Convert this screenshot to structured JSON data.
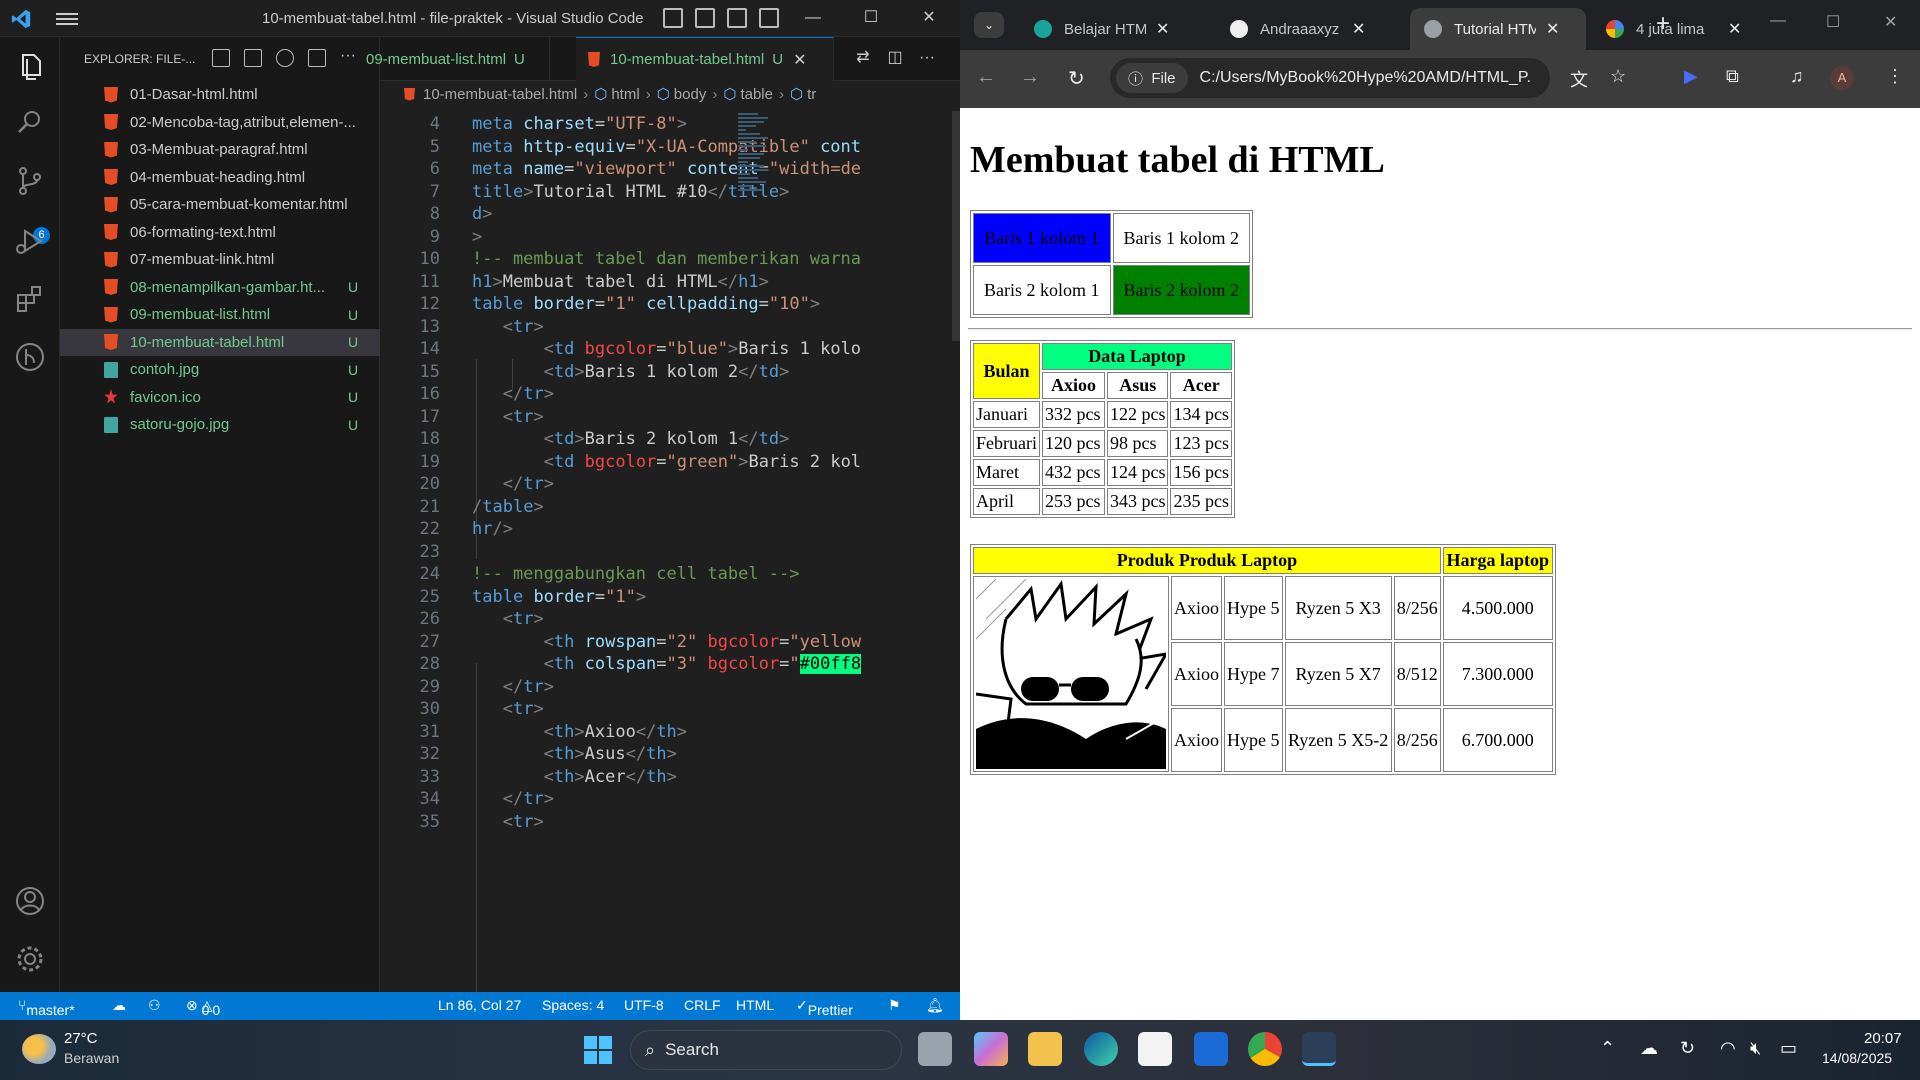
{
  "vscode": {
    "window_title": "10-membuat-tabel.html - file-praktek - Visual Studio Code",
    "explorer_title": "EXPLORER: FILE-...",
    "files": [
      {
        "name": "01-Dasar-html.html",
        "status": ""
      },
      {
        "name": "02-Mencoba-tag,atribut,elemen-...",
        "status": ""
      },
      {
        "name": "03-Membuat-paragraf.html",
        "status": ""
      },
      {
        "name": "04-membuat-heading.html",
        "status": ""
      },
      {
        "name": "05-cara-membuat-komentar.html",
        "status": ""
      },
      {
        "name": "06-formating-text.html",
        "status": ""
      },
      {
        "name": "07-membuat-link.html",
        "status": ""
      },
      {
        "name": "08-menampilkan-gambar.ht...",
        "status": "U"
      },
      {
        "name": "09-membuat-list.html",
        "status": "U"
      },
      {
        "name": "10-membuat-tabel.html",
        "status": "U"
      },
      {
        "name": "contoh.jpg",
        "status": "U"
      },
      {
        "name": "favicon.ico",
        "status": "U"
      },
      {
        "name": "satoru-gojo.jpg",
        "status": "U"
      }
    ],
    "scm_badge": "6",
    "tabs": [
      {
        "label": "09-membuat-list.html",
        "mark": "U"
      },
      {
        "label": "10-membuat-tabel.html",
        "mark": "U"
      }
    ],
    "breadcrumb": [
      "10-membuat-tabel.html",
      "html",
      "body",
      "table",
      "tr"
    ],
    "line_numbers": [
      "4",
      "5",
      "6",
      "7",
      "8",
      "9",
      "10",
      "11",
      "12",
      "13",
      "14",
      "15",
      "16",
      "17",
      "18",
      "19",
      "20",
      "21",
      "22",
      "23",
      "24",
      "25",
      "26",
      "27",
      "28",
      "29",
      "30",
      "31",
      "32",
      "33",
      "34",
      "35"
    ],
    "status": {
      "branch": "master*",
      "problems": "0",
      "warnings": "0",
      "cursor": "Ln 86, Col 27",
      "spaces": "Spaces: 4",
      "encoding": "UTF-8",
      "eol": "CRLF",
      "language": "HTML",
      "formatter": "Prettier"
    }
  },
  "chrome": {
    "tabs": [
      {
        "title": "Belajar HTML"
      },
      {
        "title": "Andraaaxyz"
      },
      {
        "title": "Tutorial HTML"
      },
      {
        "title": "4 juta lima"
      }
    ],
    "site_chip": "File",
    "url": "C:/Users/MyBook%20Hype%20AMD/HTML_P...",
    "avatar": "A"
  },
  "page": {
    "heading": "Membuat tabel di HTML",
    "table1": [
      [
        {
          "text": "Baris 1 kolom 1",
          "bg": "#0000ff"
        },
        {
          "text": "Baris 1 kolom 2",
          "bg": ""
        }
      ],
      [
        {
          "text": "Baris 2 kolom 1",
          "bg": ""
        },
        {
          "text": "Baris 2 kolom 2",
          "bg": "#008000"
        }
      ]
    ],
    "table2": {
      "bulan_header": "Bulan",
      "group_header": "Data Laptop",
      "brands": [
        "Axioo",
        "Asus",
        "Acer"
      ],
      "rows": [
        {
          "month": "Januari",
          "values": [
            "332 pcs",
            "122 pcs",
            "134 pcs"
          ]
        },
        {
          "month": "Februari",
          "values": [
            "120 pcs",
            "98 pcs",
            "123 pcs"
          ]
        },
        {
          "month": "Maret",
          "values": [
            "432 pcs",
            "124 pcs",
            "156 pcs"
          ]
        },
        {
          "month": "April",
          "values": [
            "253 pcs",
            "343 pcs",
            "235 pcs"
          ]
        }
      ],
      "yellow": "#ffff00",
      "green": "#00ff80"
    },
    "table3": {
      "header_product": "Produk Produk Laptop",
      "header_price": "Harga laptop",
      "rows": [
        {
          "brand": "Axioo",
          "model": "Hype 5",
          "cpu": "Ryzen 5 X3",
          "mem": "8/256",
          "price": "4.500.000"
        },
        {
          "brand": "Axioo",
          "model": "Hype 7",
          "cpu": "Ryzen 5 X7",
          "mem": "8/512",
          "price": "7.300.000"
        },
        {
          "brand": "Axioo",
          "model": "Hype 5",
          "cpu": "Ryzen 5 X5-2",
          "mem": "8/256",
          "price": "6.700.000"
        }
      ]
    }
  },
  "taskbar": {
    "temperature": "27°C",
    "weather": "Berawan",
    "search_label": "Search",
    "time": "20:07",
    "date": "14/08/2025"
  }
}
